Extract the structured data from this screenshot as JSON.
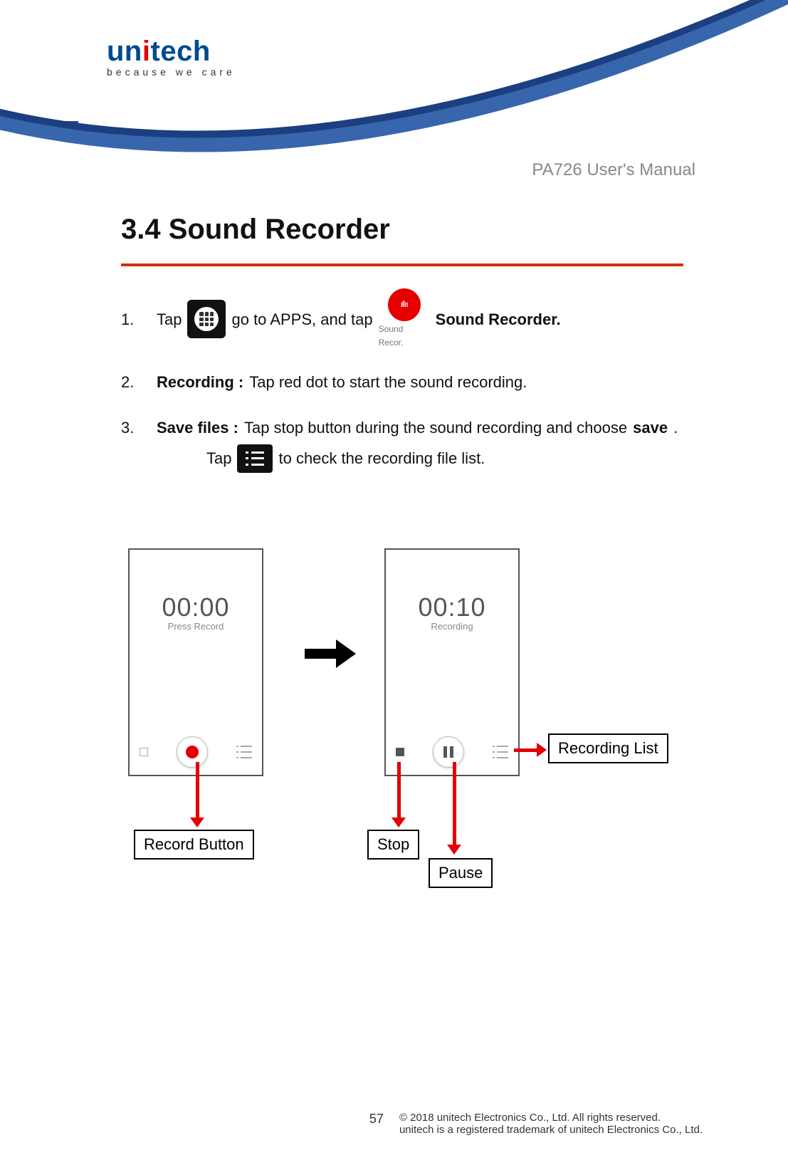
{
  "header": {
    "brand_prefix": "un",
    "brand_i": "i",
    "brand_suffix": "tech",
    "tagline": "because we care",
    "manual_title": "PA726 User's Manual"
  },
  "section": {
    "heading": "3.4 Sound Recorder"
  },
  "steps": {
    "s1_num": "1.",
    "s1_a": "Tap",
    "s1_b": "go to APPS, and tap",
    "s1_sr_label": "Sound Recor.",
    "s1_c": "Sound Recorder.",
    "s2_num": "2.",
    "s2_bold": "Recording :",
    "s2_text": "Tap red dot to start the sound recording.",
    "s3_num": "3.",
    "s3_bold": "Save files :",
    "s3_text_a": "Tap stop button during the sound recording and choose",
    "s3_save": "save",
    "s3_dot": ".",
    "s3_indent_a": "Tap",
    "s3_indent_b": "to check the recording file list."
  },
  "phone1": {
    "timer": "00:00",
    "status": "Press Record"
  },
  "phone2": {
    "timer": "00:10",
    "status": "Recording"
  },
  "callouts": {
    "record": "Record Button",
    "stop": "Stop",
    "pause": "Pause",
    "reclist": "Recording List"
  },
  "footer": {
    "page": "57",
    "line1": "© 2018 unitech Electronics Co., Ltd. All rights reserved.",
    "line2": "unitech is a registered trademark of unitech Electronics Co., Ltd."
  }
}
